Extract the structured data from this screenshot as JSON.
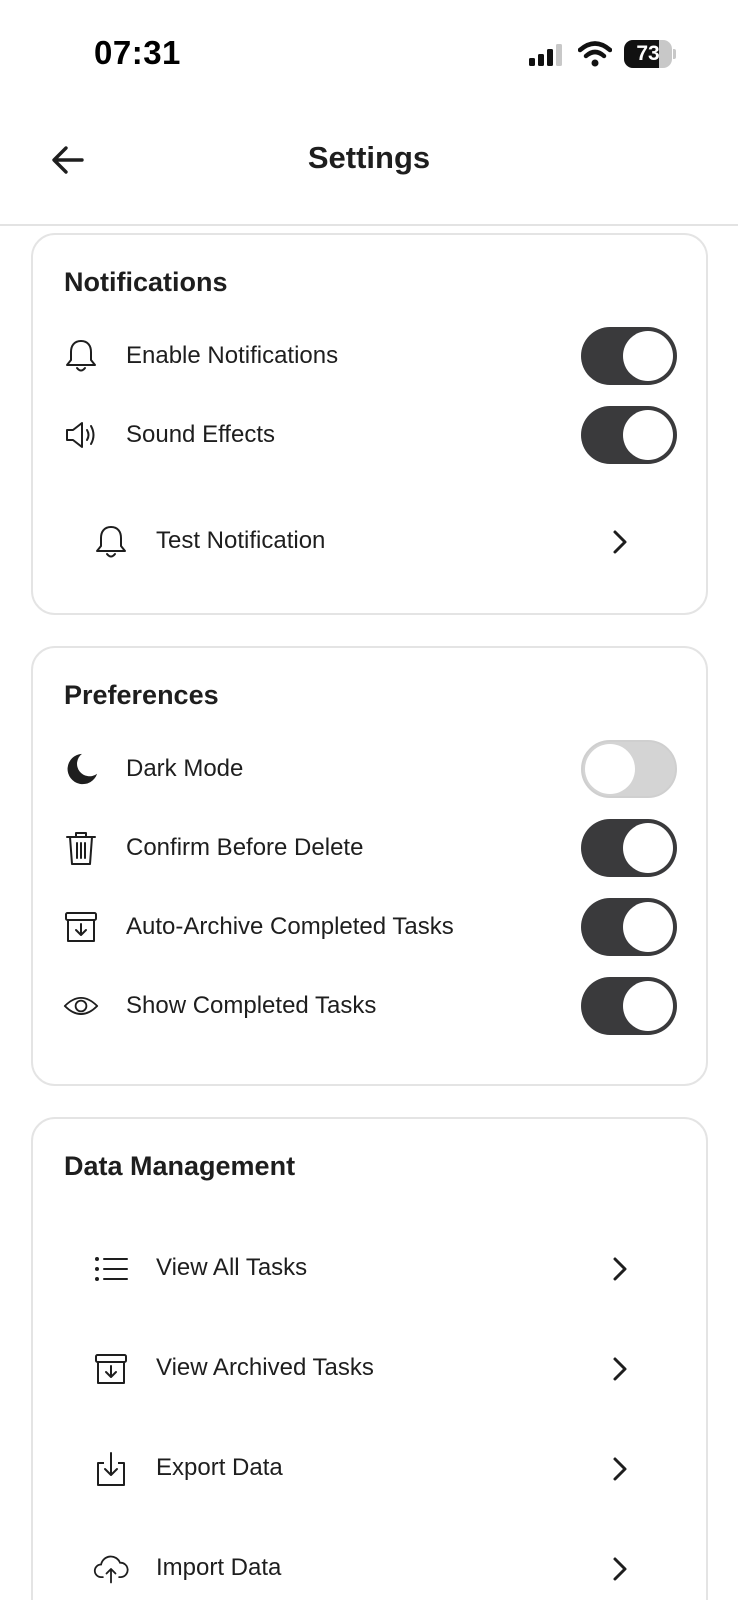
{
  "status_bar": {
    "time": "07:31",
    "battery_level": "73",
    "battery_fraction": 0.73
  },
  "header": {
    "title": "Settings",
    "back_icon": "arrow-left-icon"
  },
  "notifications": {
    "title": "Notifications",
    "items": [
      {
        "label": "Enable Notifications",
        "icon": "bell-icon",
        "enabled": true
      },
      {
        "label": "Sound Effects",
        "icon": "speaker-icon",
        "enabled": true
      }
    ],
    "test_label": "Test Notification",
    "test_icon": "bell-icon"
  },
  "preferences": {
    "title": "Preferences",
    "items": [
      {
        "label": "Dark Mode",
        "icon": "moon-icon",
        "enabled": false
      },
      {
        "label": "Confirm Before Delete",
        "icon": "trash-icon",
        "enabled": true
      },
      {
        "label": "Auto-Archive Completed Tasks",
        "icon": "archive-icon",
        "enabled": true
      },
      {
        "label": "Show Completed Tasks",
        "icon": "eye-icon",
        "enabled": true
      }
    ]
  },
  "data_management": {
    "title": "Data Management",
    "items": [
      {
        "label": "View All Tasks",
        "icon": "list-icon"
      },
      {
        "label": "View Archived Tasks",
        "icon": "archive-icon"
      },
      {
        "label": "Export Data",
        "icon": "download-icon"
      },
      {
        "label": "Import Data",
        "icon": "cloud-upload-icon"
      }
    ]
  },
  "colors": {
    "toggle_on": "#3a3a3c",
    "toggle_off": "#d4d4d4",
    "card_border": "#e4e4e4",
    "text": "#1e1e1e"
  }
}
